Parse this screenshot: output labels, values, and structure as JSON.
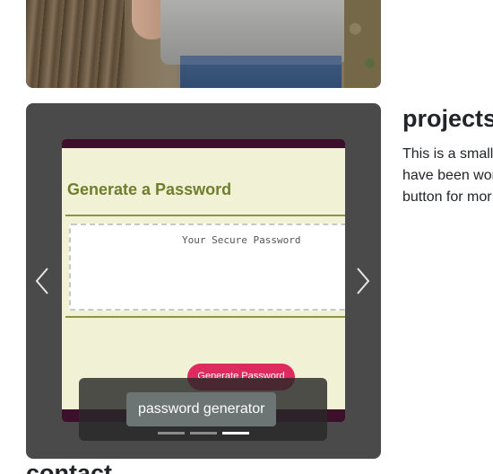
{
  "photo": {
    "alt": ""
  },
  "carousel": {
    "slide": {
      "app_title": "Generate a Password",
      "password_placeholder": "Your Secure Password",
      "button_label": "Generate Password"
    },
    "caption": "password generator",
    "indicator_count": 3,
    "active_indicator": 3
  },
  "projects": {
    "heading": "projects",
    "lines": [
      "This is a small",
      "have been wor",
      "button for mor"
    ]
  },
  "contact": {
    "heading": "contact"
  },
  "colors": {
    "carousel_bg": "#4a4a4a",
    "slide_bg": "#f1f1d5",
    "slide_bar": "#3c0f2a",
    "title_green": "#6d7f2c",
    "button_pink": "#dd2a5f",
    "caption_label_bg": "#6c7474"
  },
  "icons": {
    "prev": "chevron-left-icon",
    "next": "chevron-right-icon"
  }
}
